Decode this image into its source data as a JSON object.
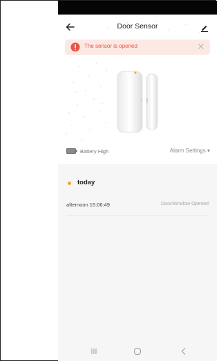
{
  "header": {
    "title": "Door Sensor"
  },
  "alert": {
    "message": "The sensor is opened"
  },
  "status": {
    "battery": "Battery High",
    "alarm_settings": "Alarm Settings ▾"
  },
  "log": {
    "day": "today",
    "events": [
      {
        "time": "afternoon  15:06:49",
        "description": "Door/Window Opened"
      }
    ]
  },
  "colors": {
    "accent": "#f5a623",
    "alert_text": "#e8544a",
    "alert_bg": "#fde9e3"
  },
  "icons": [
    "back-arrow-icon",
    "edit-pencil-icon",
    "alert-exclamation-icon",
    "close-icon",
    "battery-icon",
    "recent-apps-icon",
    "home-icon",
    "back-nav-icon"
  ]
}
